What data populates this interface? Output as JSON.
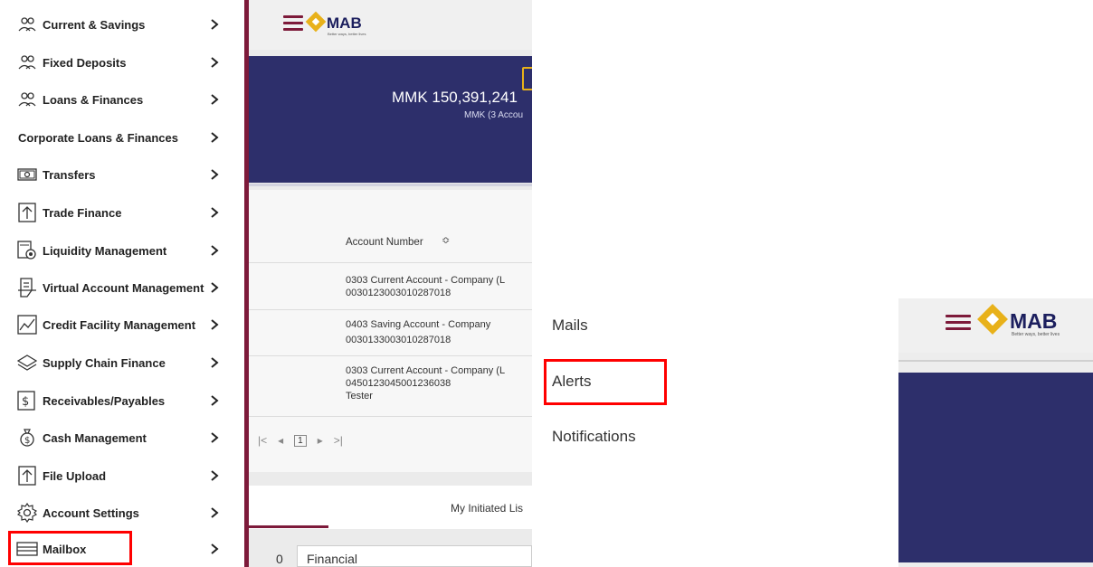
{
  "sidebar": {
    "items": [
      {
        "label": "Current & Savings",
        "icon": "users-icon"
      },
      {
        "label": "Fixed Deposits",
        "icon": "users-icon"
      },
      {
        "label": "Loans & Finances",
        "icon": "users-icon"
      },
      {
        "label": "Corporate Loans & Finances",
        "icon": ""
      },
      {
        "label": "Transfers",
        "icon": "money-note-icon"
      },
      {
        "label": "Trade Finance",
        "icon": "upload-arrow-icon"
      },
      {
        "label": "Liquidity Management",
        "icon": "liquidity-icon"
      },
      {
        "label": "Virtual Account Management",
        "icon": "document-icon"
      },
      {
        "label": "Credit Facility Management",
        "icon": "trend-chart-icon"
      },
      {
        "label": "Supply Chain Finance",
        "icon": "layers-icon"
      },
      {
        "label": "Receivables/Payables",
        "icon": "dollar-document-icon"
      },
      {
        "label": "Cash Management",
        "icon": "money-bag-icon"
      },
      {
        "label": "File Upload",
        "icon": "upload-arrow-icon"
      },
      {
        "label": "Account Settings",
        "icon": "gear-icon"
      },
      {
        "label": "Mailbox",
        "icon": "mailbox-icon"
      }
    ],
    "highlighted": "Mailbox"
  },
  "dashboard": {
    "logo_text": "MAB",
    "logo_tagline": "Better ways, better lives",
    "balance_amount": "MMK 150,391,241",
    "balance_sub": "MMK (3 Accou",
    "column_header": "Account Number",
    "rows": [
      {
        "line1": "0303 Current Account - Company (L",
        "line2": "0030123003010287018",
        "line3": ""
      },
      {
        "line1": "0403 Saving Account - Company",
        "line2": "0030133003010287018",
        "line3": ""
      },
      {
        "line1": "0303 Current Account - Company (L",
        "line2": "0450123045001236038",
        "line3": "Tester"
      }
    ],
    "pager": {
      "first": "|<",
      "prev": "◂",
      "current": "1",
      "next": "▸",
      "last": ">|"
    },
    "tab_label": "My Initiated Lis",
    "bottom_count": "0",
    "bottom_label": "Financial"
  },
  "mailbox_submenu": {
    "items": [
      "Mails",
      "Alerts",
      "Notifications"
    ],
    "highlighted": "Alerts"
  },
  "panel3": {
    "logo_text": "MAB",
    "logo_tagline": "Better ways, better lives"
  },
  "colors": {
    "brand_maroon": "#7d1a3a",
    "brand_navy": "#2d2f6b",
    "brand_gold": "#e8b11a",
    "highlight_red": "#ff0000"
  }
}
